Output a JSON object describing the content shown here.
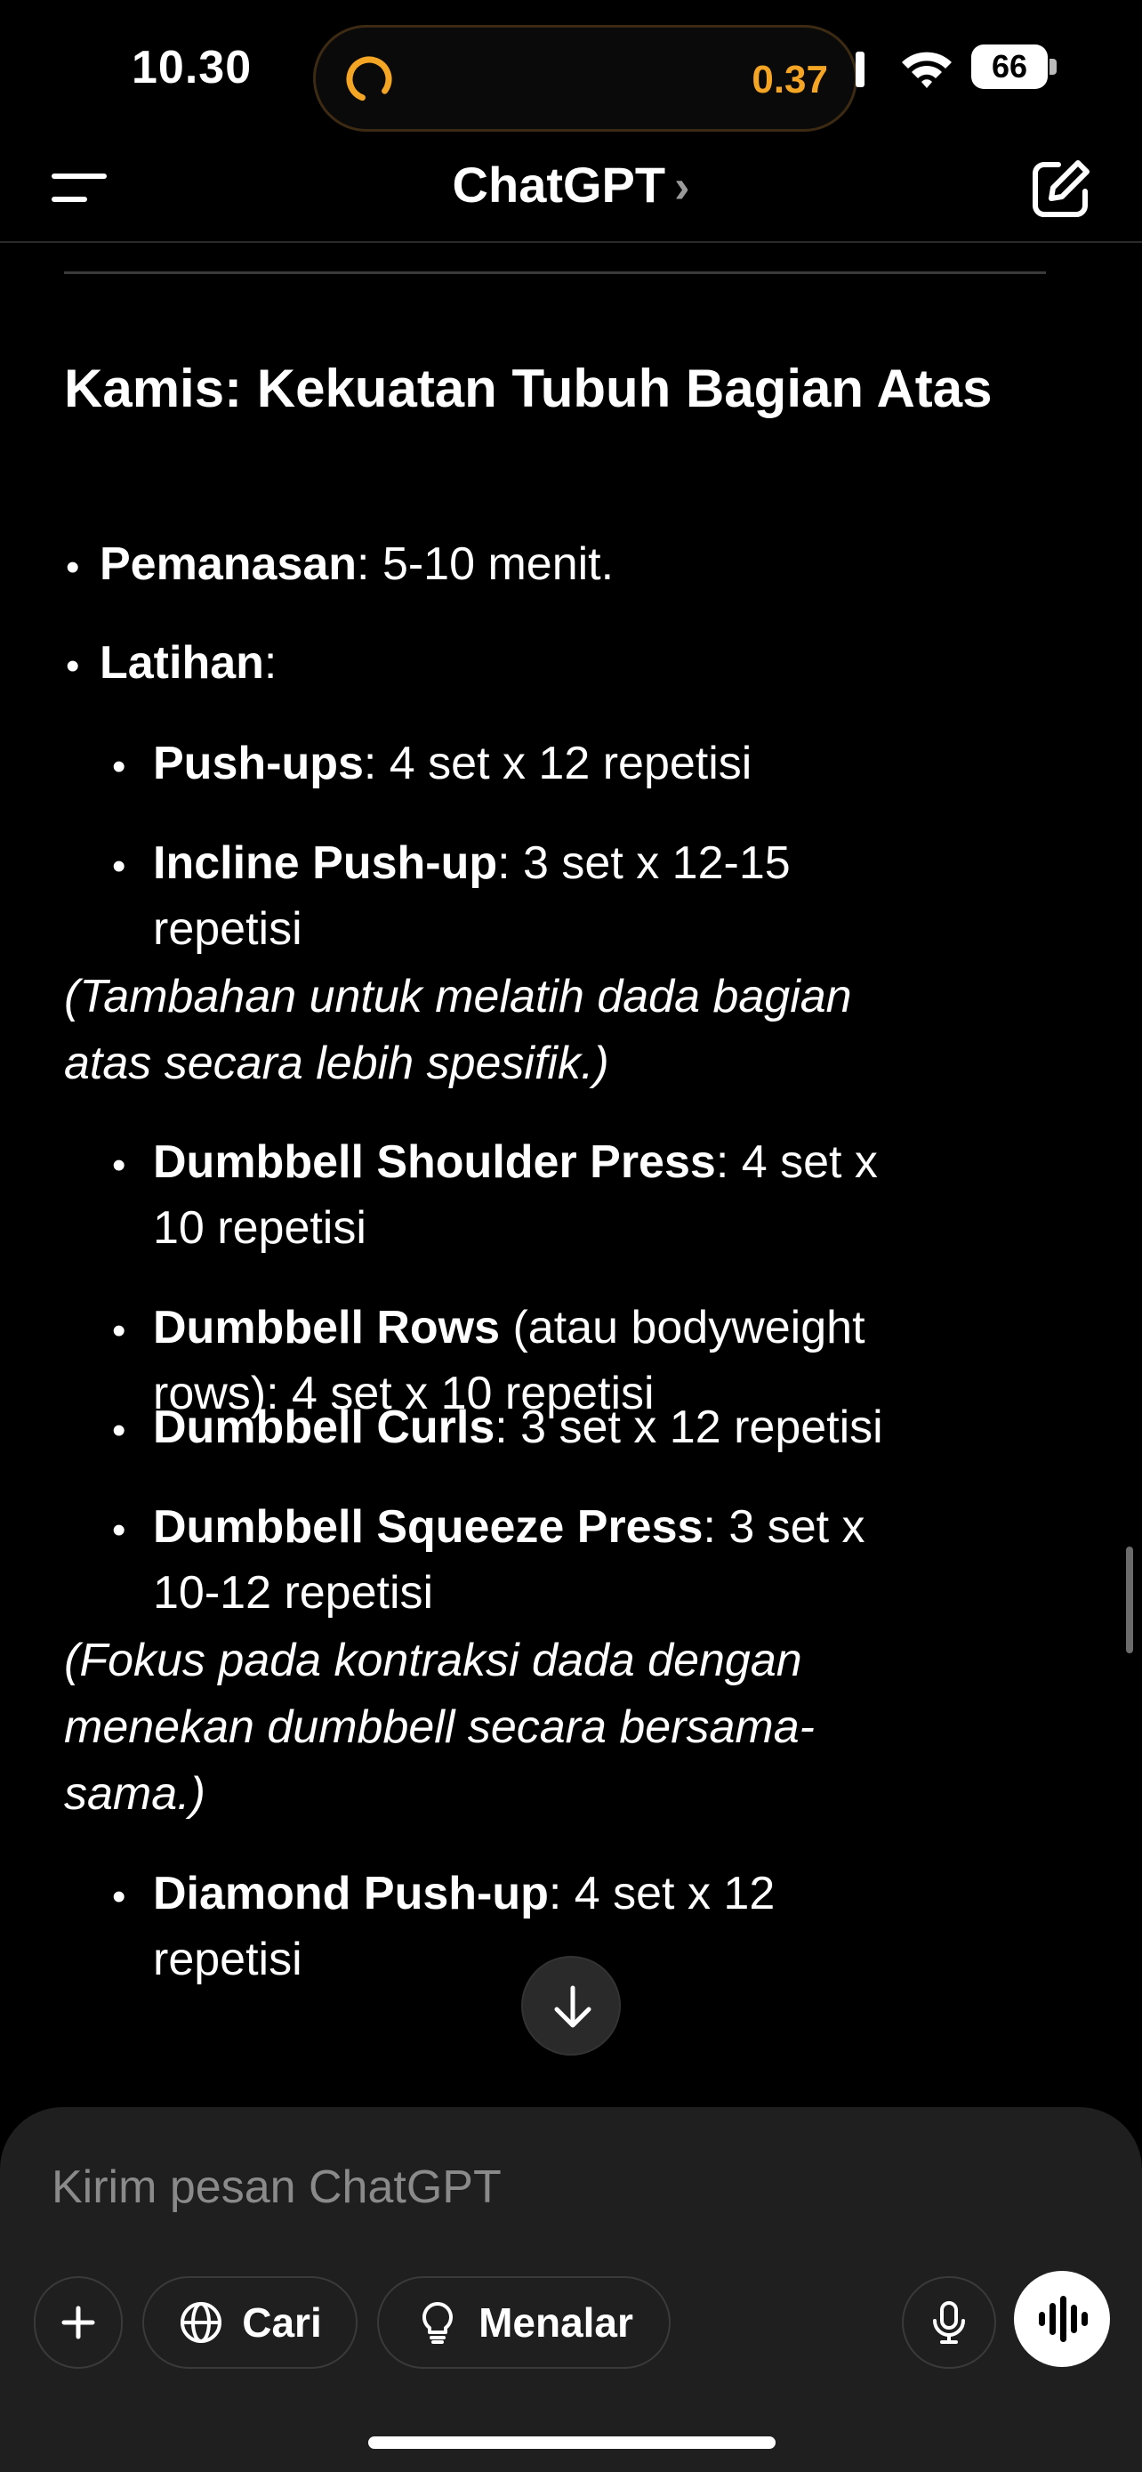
{
  "status_bar": {
    "time": "10.30",
    "island_value": "0.37",
    "battery": "66",
    "accent_color": "#f5a524"
  },
  "navbar": {
    "title": "ChatGPT",
    "chevron": "›",
    "menu_icon": "menu-icon",
    "edit_icon": "new-chat-icon"
  },
  "message": {
    "heading": "Kamis: Kekuatan Tubuh Bagian Atas",
    "warmup_label": "Pemanasan",
    "warmup_text": ": 5-10 menit.",
    "exercises_label": "Latihan",
    "exercises_colon": ":",
    "pushups_label": "Push-ups",
    "pushups_text": ": 4 set x 12 repetisi",
    "incline_label": "Incline Push-up",
    "incline_text": ": 3 set x 12-15",
    "incline_text2": "repetisi",
    "incline_note1": "(Tambahan untuk melatih dada bagian",
    "incline_note2": "atas secara lebih spesifik.)",
    "shoulder_label": "Dumbbell Shoulder Press",
    "shoulder_text": ": 4 set x",
    "shoulder_text2": "10 repetisi",
    "rows_label": "Dumbbell Rows",
    "rows_text": " (atau bodyweight",
    "rows_text2": "rows): 4 set x 10 repetisi",
    "curls_label": "Dumbbell Curls",
    "curls_text": ": 3 set x 12 repetisi",
    "squeeze_label": "Dumbbell Squeeze Press",
    "squeeze_text": ": 3 set x",
    "squeeze_text2": "10-12 repetisi",
    "squeeze_note1": "(Fokus pada kontraksi dada dengan",
    "squeeze_note2": "menekan dumbbell secara bersama-",
    "squeeze_note3": "sama.)",
    "diamond_label": "Diamond Push-up",
    "diamond_text": ": 4 set x 12",
    "diamond_text2": "repetisi"
  },
  "composer": {
    "placeholder": "Kirim pesan ChatGPT",
    "search_label": "Cari",
    "reason_label": "Menalar"
  }
}
